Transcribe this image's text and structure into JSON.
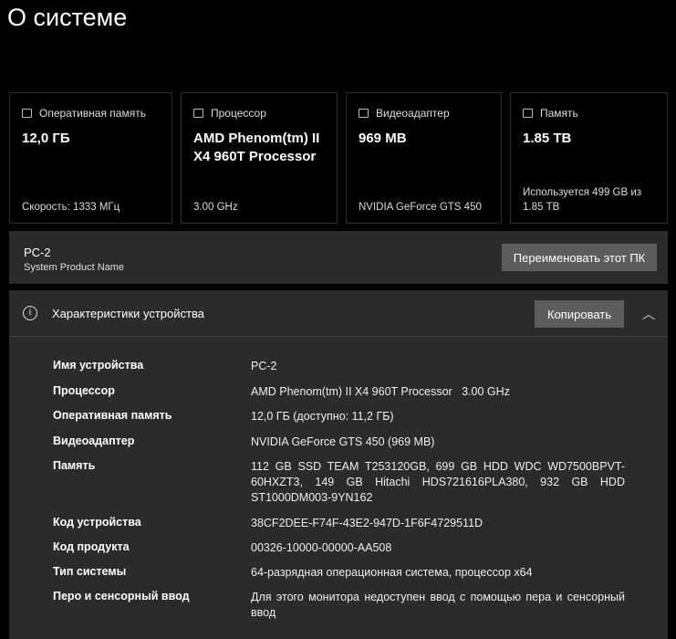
{
  "title": "О системе",
  "cards": [
    {
      "label": "Оперативная память",
      "icon": "ram-icon",
      "value": "12,0 ГБ",
      "sub": "Скорость: 1333 МГц"
    },
    {
      "label": "Процессор",
      "icon": "cpu-icon",
      "value": "AMD Phenom(tm) II X4 960T Processor",
      "sub": "3.00 GHz"
    },
    {
      "label": "Видеоадаптер",
      "icon": "gpu-icon",
      "value": "969 MB",
      "sub": "NVIDIA GeForce GTS 450"
    },
    {
      "label": "Память",
      "icon": "storage-icon",
      "value": "1.85 TB",
      "sub": "Используется 499 GB из 1.85 TB"
    }
  ],
  "pc": {
    "name": "PC-2",
    "model": "System Product Name",
    "rename": "Переименовать этот ПК"
  },
  "specs": {
    "title": "Характеристики устройства",
    "copy": "Копировать",
    "rows": [
      {
        "k": "Имя устройства",
        "v": "PC-2"
      },
      {
        "k": "Процессор",
        "v": "AMD Phenom(tm) II X4 960T Processor   3.00 GHz"
      },
      {
        "k": "Оперативная память",
        "v": "12,0 ГБ (доступно: 11,2 ГБ)"
      },
      {
        "k": "Видеоадаптер",
        "v": "NVIDIA GeForce GTS 450 (969 MB)"
      },
      {
        "k": "Память",
        "v": "112 GB SSD TEAM T253120GB, 699 GB HDD WDC WD7500BPVT-60HXZT3, 149 GB Hitachi HDS721616PLA380, 932 GB HDD ST1000DM003-9YN162"
      },
      {
        "k": "Код устройства",
        "v": "38CF2DEE-F74F-43E2-947D-1F6F4729511D"
      },
      {
        "k": "Код продукта",
        "v": "00326-10000-00000-AA508"
      },
      {
        "k": "Тип системы",
        "v": "64-разрядная операционная система, процессор x64"
      },
      {
        "k": "Перо и сенсорный ввод",
        "v": "Для этого монитора недоступен ввод с помощью пера и сенсорный ввод"
      }
    ]
  }
}
